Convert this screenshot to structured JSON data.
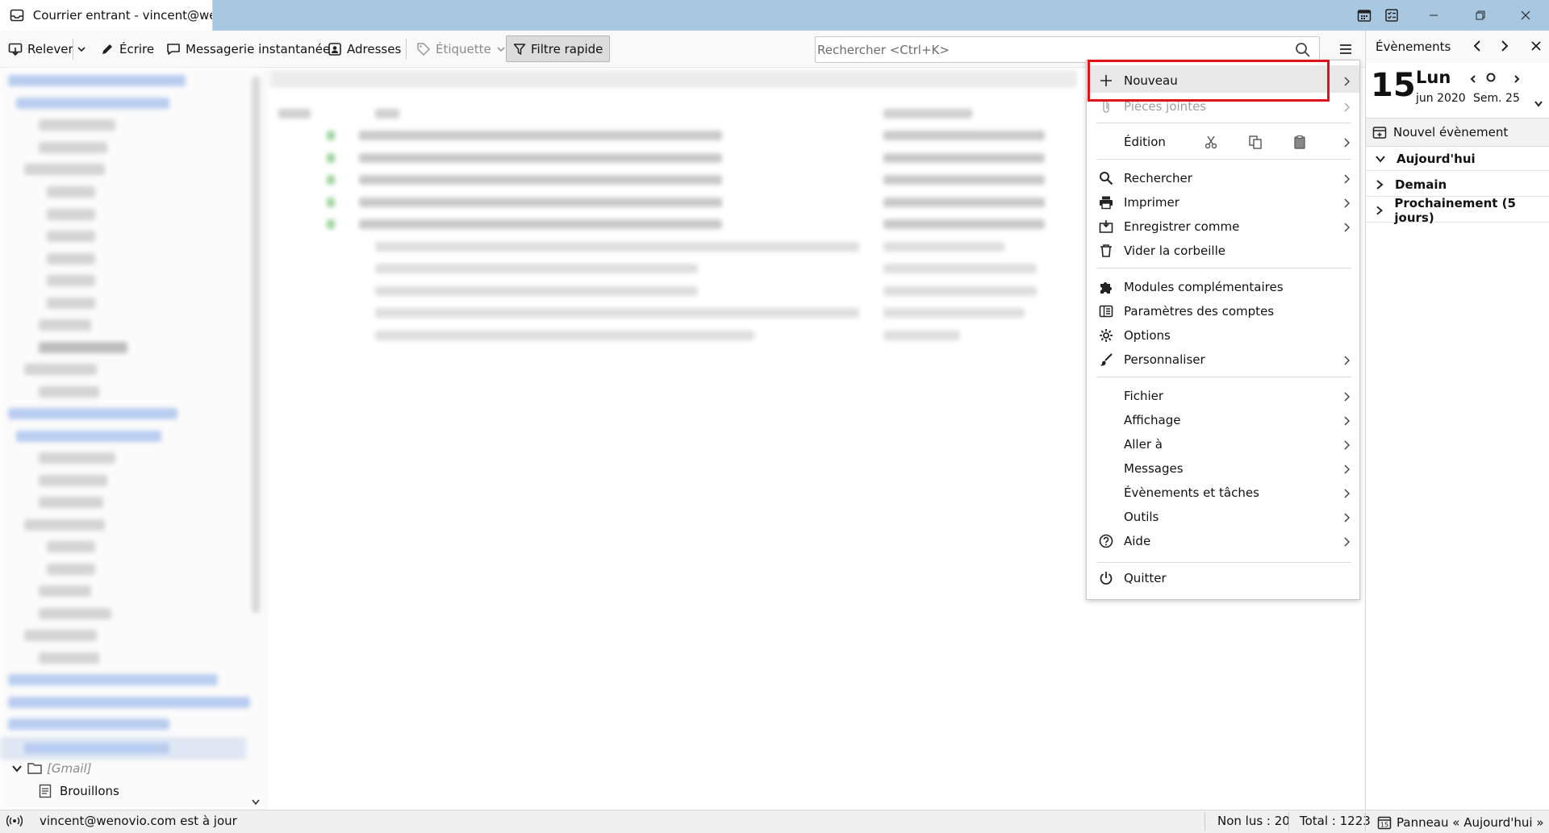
{
  "window": {
    "tab_title": "Courrier entrant - vincent@wen",
    "minimize": "—",
    "restore": "❐",
    "close": "✕"
  },
  "toolbar": {
    "get_messages": "Relever",
    "write": "Écrire",
    "chat": "Messagerie instantanée",
    "address_book": "Adresses",
    "tag": "Étiquette",
    "quick_filter": "Filtre rapide"
  },
  "search": {
    "placeholder": "Rechercher <Ctrl+K>"
  },
  "folders": {
    "gmail_label": "[Gmail]",
    "drafts_label": "Brouillons"
  },
  "statusbar": {
    "account_status": "vincent@wenovio.com est à jour",
    "unread": "Non lus : 20",
    "total": "Total : 1223",
    "today_pane": "Panneau « Aujourd'hui »"
  },
  "today_pane": {
    "title": "Évènements",
    "day_number": "15",
    "weekday": "Lun",
    "month_year": "jun 2020",
    "week": "Sem. 25",
    "new_event": "Nouvel évènement",
    "sections": [
      "Aujourd'hui",
      "Demain",
      "Prochainement (5 jours)"
    ]
  },
  "menu": {
    "new": "Nouveau",
    "attachments": "Pièces jointes",
    "edit": "Édition",
    "find": "Rechercher",
    "print": "Imprimer",
    "save_as": "Enregistrer comme",
    "empty_trash": "Vider la corbeille",
    "addons": "Modules complémentaires",
    "account_settings": "Paramètres des comptes",
    "options": "Options",
    "customize": "Personnaliser",
    "file": "Fichier",
    "view": "Affichage",
    "go": "Aller à",
    "messages": "Messages",
    "events_tasks": "Évènements et tâches",
    "tools": "Outils",
    "help": "Aide",
    "quit": "Quitter"
  },
  "colors": {
    "titlebar": "#a8c8e1",
    "highlight_box": "#e2121b",
    "menu_hover": "#e8e8e8"
  }
}
